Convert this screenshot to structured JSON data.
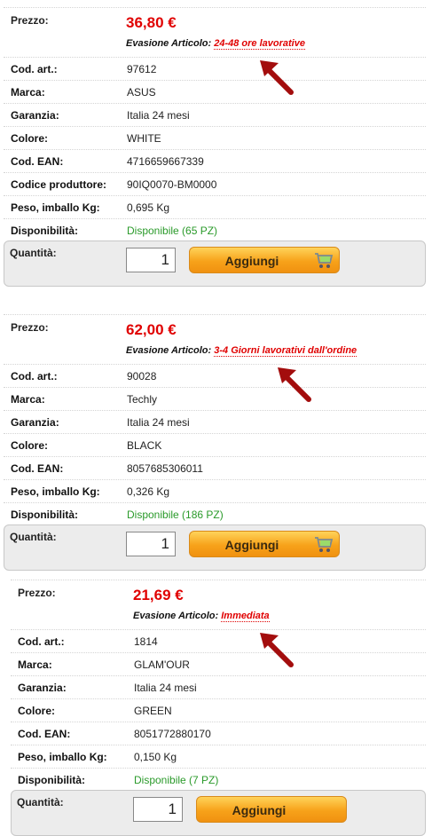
{
  "labels": {
    "price": "Prezzo:",
    "evasion": "Evasione Articolo:",
    "code": "Cod. art.:",
    "brand": "Marca:",
    "warranty": "Garanzia:",
    "color": "Colore:",
    "ean": "Cod. EAN:",
    "mfr_code": "Codice produttore:",
    "weight": "Peso, imballo Kg:",
    "availability": "Disponibilità:",
    "quantity": "Quantità:",
    "add_button": "Aggiungi"
  },
  "products": [
    {
      "price": "36,80 €",
      "evasion": "24-48 ore lavorative",
      "code": "97612",
      "brand": "ASUS",
      "warranty": "Italia 24 mesi",
      "color": "WHITE",
      "ean": "4716659667339",
      "mfr_code": "90IQ0070-BM0000",
      "weight": "0,695 Kg",
      "availability": "Disponibile (65 PZ)",
      "quantity": "1"
    },
    {
      "price": "62,00 €",
      "evasion": "3-4 Giorni lavorativi dall'ordine",
      "code": "90028",
      "brand": "Techly",
      "warranty": "Italia 24 mesi",
      "color": "BLACK",
      "ean": "8057685306011",
      "weight": "0,326 Kg",
      "availability": "Disponibile (186 PZ)",
      "quantity": "1"
    },
    {
      "price": "21,69 €",
      "evasion": "Immediata",
      "code": "1814",
      "brand": "GLAM'OUR",
      "warranty": "Italia 24 mesi",
      "color": "GREEN",
      "ean": "8051772880170",
      "weight": "0,150 Kg",
      "availability": "Disponibile (7 PZ)",
      "quantity": "1"
    }
  ],
  "colors": {
    "price": "#e00000",
    "available": "#2a9a2a",
    "button": "#f7a21a",
    "arrow": "#a30d0d"
  }
}
